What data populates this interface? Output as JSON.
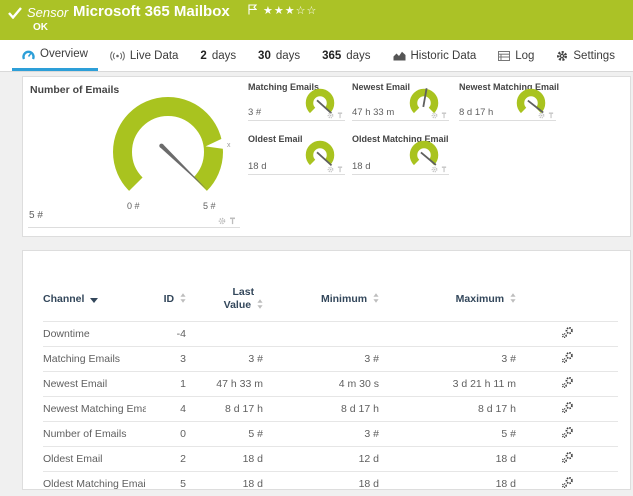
{
  "colors": {
    "green": "#abc226",
    "gauge_green": "#a9c31f",
    "accent_blue": "#2d9fd8",
    "header_navy": "#33475b"
  },
  "header": {
    "kind": "Sensor",
    "title": "Microsoft 365 Mailbox",
    "status": "OK",
    "stars": "★★★☆☆",
    "stars_filled": 3,
    "stars_total": 5
  },
  "tabs": {
    "overview": "Overview",
    "live_data": "Live Data",
    "d2_num": "2",
    "d2_word": "days",
    "d30_num": "30",
    "d30_word": "days",
    "d365_num": "365",
    "d365_word": "days",
    "historic": "Historic Data",
    "log": "Log",
    "settings": "Settings"
  },
  "gauges": {
    "main": {
      "title": "Number of Emails",
      "value": "5 #",
      "scale_min": "0 #",
      "scale_max": "5 #",
      "marker": "x"
    },
    "small": [
      {
        "title": "Matching Emails",
        "value": "3 #"
      },
      {
        "title": "Newest Email",
        "value": "47 h 33 m"
      },
      {
        "title": "Newest Matching Email",
        "value": "8 d 17 h"
      },
      {
        "title": "Oldest Email",
        "value": "18 d"
      },
      {
        "title": "Oldest Matching Email",
        "value": "18 d"
      }
    ]
  },
  "table": {
    "headers": {
      "channel": "Channel",
      "id": "ID",
      "last1": "Last",
      "last2": "Value",
      "minimum": "Minimum",
      "maximum": "Maximum"
    },
    "rows": [
      {
        "channel": "Downtime",
        "id": "-4",
        "last": "",
        "min": "",
        "max": ""
      },
      {
        "channel": "Matching Emails",
        "id": "3",
        "last": "3 #",
        "min": "3 #",
        "max": "3 #"
      },
      {
        "channel": "Newest Email",
        "id": "1",
        "last": "47 h 33 m",
        "min": "4 m 30 s",
        "max": "3 d 21 h 11 m"
      },
      {
        "channel": "Newest Matching Email",
        "id": "4",
        "last": "8 d 17 h",
        "min": "8 d 17 h",
        "max": "8 d 17 h"
      },
      {
        "channel": "Number of Emails",
        "id": "0",
        "last": "5 #",
        "min": "3 #",
        "max": "5 #"
      },
      {
        "channel": "Oldest Email",
        "id": "2",
        "last": "18 d",
        "min": "12 d",
        "max": "18 d"
      },
      {
        "channel": "Oldest Matching Email",
        "id": "5",
        "last": "18 d",
        "min": "18 d",
        "max": "18 d"
      }
    ]
  }
}
